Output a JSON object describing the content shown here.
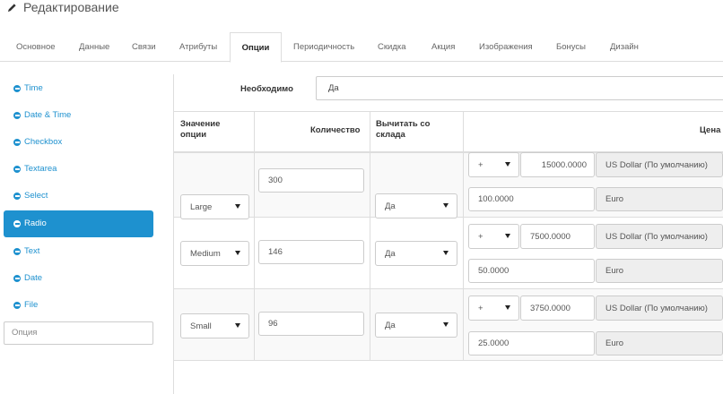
{
  "heading": "Редактирование",
  "tabs": [
    "Основное",
    "Данные",
    "Связи",
    "Атрибуты",
    "Опции",
    "Периодичность",
    "Скидка",
    "Акция",
    "Изображения",
    "Бонусы",
    "Дизайн"
  ],
  "active_tab": "Опции",
  "sidebar": {
    "items": [
      "Time",
      "Date & Time",
      "Checkbox",
      "Textarea",
      "Select",
      "Radio",
      "Text",
      "Date",
      "File"
    ],
    "active": "Radio",
    "option_placeholder": "Опция"
  },
  "required": {
    "label": "Необходимо",
    "value": "Да"
  },
  "table": {
    "headers": {
      "value": "Значение опции",
      "quantity": "Количество",
      "subtract": "Вычитать со склада",
      "price": "Цена"
    },
    "rows": [
      {
        "value": "Large",
        "quantity": "300",
        "subtract": "Да",
        "prefix": "+",
        "price": "15000.0000",
        "currency": "US Dollar (По умолчанию)",
        "price2": "100.0000",
        "currency2": "Euro"
      },
      {
        "value": "Medium",
        "quantity": "146",
        "subtract": "Да",
        "prefix": "+",
        "price": "7500.0000",
        "currency": "US Dollar (По умолчанию)",
        "price2": "50.0000",
        "currency2": "Euro"
      },
      {
        "value": "Small",
        "quantity": "96",
        "subtract": "Да",
        "prefix": "+",
        "price": "3750.0000",
        "currency": "US Dollar (По умолчанию)",
        "price2": "25.0000",
        "currency2": "Euro"
      }
    ]
  },
  "colors": {
    "accent": "#1e91cf",
    "border": "#dddddd"
  }
}
